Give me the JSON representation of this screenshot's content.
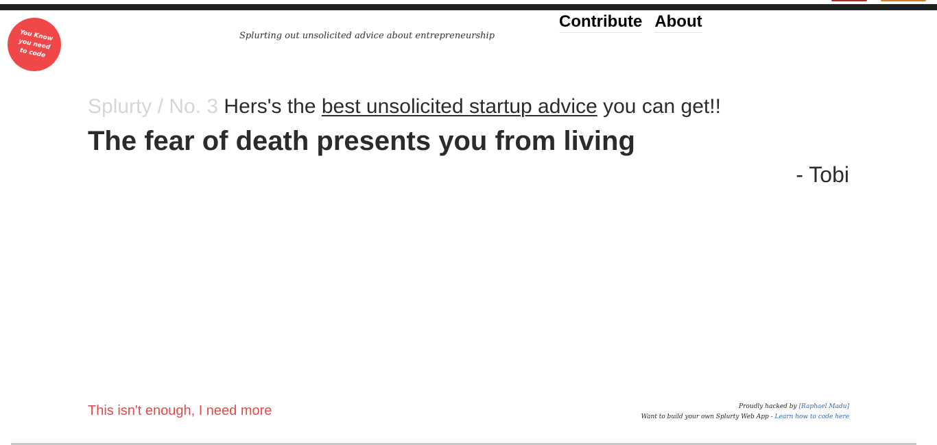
{
  "badge": {
    "text": "You Know you need to code",
    "color": "#f04848"
  },
  "header": {
    "tagline": "Splurting out unsolicited advice about entrepreneurship",
    "nav": [
      {
        "label": "Contribute"
      },
      {
        "label": "About"
      }
    ]
  },
  "splurt": {
    "crumb": "Splurty / No. 3",
    "intro_before": "Hers's the",
    "intro_link": "best unsolicited startup advice",
    "intro_after": "you can get!!",
    "quote": "The fear of death presents you from living",
    "author": "- Tobi"
  },
  "footer": {
    "more_link": "This isn't enough, I need more",
    "credit_prefix": "Proudly hacked by",
    "credit_name": "[Raphael Madu]",
    "build_prefix": "Want to build your own Splurty Web App -",
    "build_link": "Learn how to code here"
  },
  "colors": {
    "accent": "#e54848",
    "crumb": "#d6d6d6",
    "link": "#2a66c4",
    "topbar": "#222222"
  }
}
